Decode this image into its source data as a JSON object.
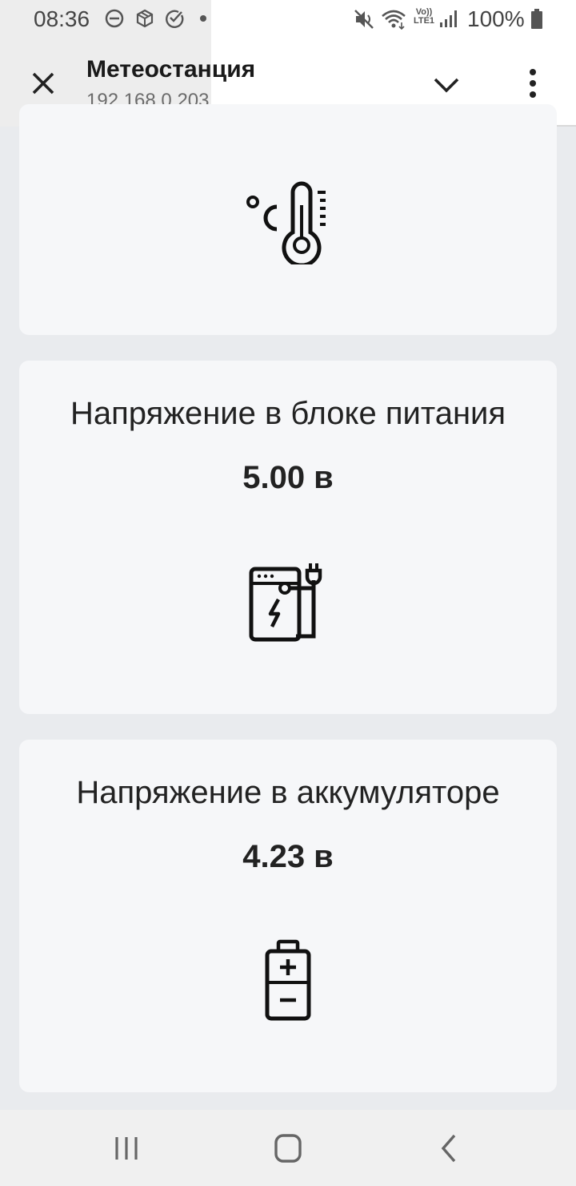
{
  "status_bar": {
    "time": "08:36",
    "battery": "100%",
    "icons": [
      "dnd-icon",
      "package-icon",
      "check-circle-icon",
      "mute-icon",
      "wifi-icon",
      "volte-icon",
      "signal-icon",
      "battery-icon"
    ],
    "volte_top": "Vo))",
    "volte_bottom": "LTE1"
  },
  "header": {
    "title": "Метеостанция",
    "subtitle": "192.168.0.203",
    "close_icon": "close-icon",
    "expand_icon": "chevron-down-icon",
    "menu_icon": "more-vert-icon"
  },
  "cards": [
    {
      "icon": "temperature-icon"
    },
    {
      "label": "Напряжение в блоке питания",
      "value": "5.00 в",
      "icon": "power-supply-icon"
    },
    {
      "label": "Напряжение в аккумуляторе",
      "value": "4.23 в",
      "icon": "battery-icon"
    }
  ],
  "navbar": {
    "icons": [
      "recent-apps-icon",
      "home-icon",
      "back-icon"
    ]
  }
}
